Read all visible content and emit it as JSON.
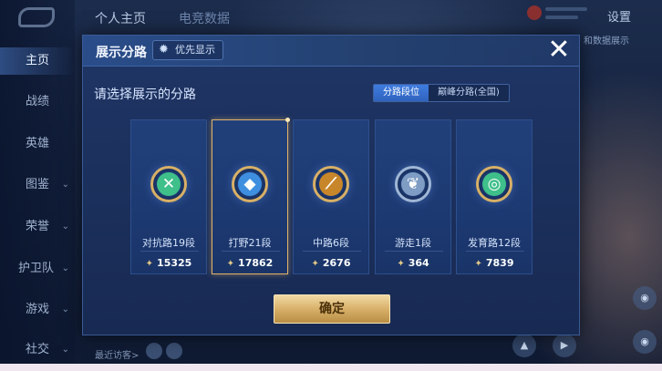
{
  "top_nav": {
    "tabs": [
      "个人主页",
      "电竞数据"
    ],
    "settings_label": "设置",
    "right_hint": "和数据展示"
  },
  "left_nav": {
    "items": [
      "主页",
      "战绩",
      "英雄",
      "图鉴",
      "荣誉",
      "护卫队",
      "游戏",
      "社交"
    ]
  },
  "bottom": {
    "hint": "最近访客>"
  },
  "modal": {
    "title": "展示分路",
    "priority_label": "优先显示",
    "prompt": "请选择展示的分路",
    "segments": [
      "分路段位",
      "巅峰分路(全国)"
    ],
    "selected_segment": "分路段位",
    "cards": [
      {
        "name": "对抗路19段",
        "score": "15325",
        "icon": "crossed-swords-icon",
        "color": "#3fbf8a",
        "selected": false
      },
      {
        "name": "打野21段",
        "score": "17862",
        "icon": "dragon-icon",
        "color": "#3f8fe0",
        "selected": true
      },
      {
        "name": "中路6段",
        "score": "2676",
        "icon": "wand-icon",
        "color": "#c8862a",
        "selected": false
      },
      {
        "name": "游走1段",
        "score": "364",
        "icon": "wings-icon",
        "color": "#7f9cc4",
        "selected": false
      },
      {
        "name": "发育路12段",
        "score": "7839",
        "icon": "target-icon",
        "color": "#3fbf8a",
        "selected": false
      }
    ],
    "confirm_label": "确定"
  },
  "colors": {
    "accent_blue": "#3f7ce0",
    "gold": "#d8b069"
  }
}
